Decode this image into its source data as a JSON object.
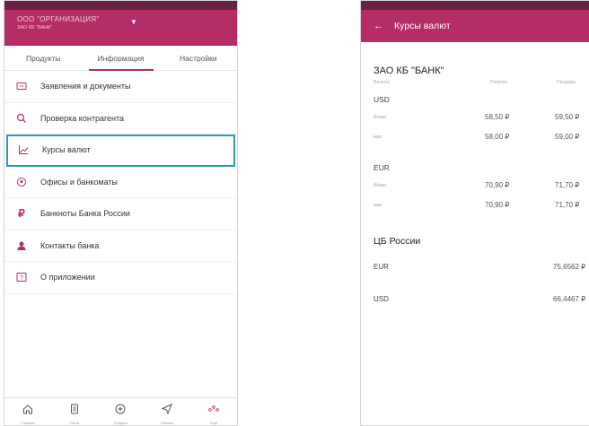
{
  "left": {
    "org_name": "ООО \"ОРГАНИЗАЦИЯ\"",
    "org_sub": "ЗАО КБ \"БАНК\"",
    "tabs": [
      "Продукты",
      "Информация",
      "Настройки"
    ],
    "menu": [
      {
        "label": "Заявления и документы",
        "icon": "envelope-icon"
      },
      {
        "label": "Проверка контрагента",
        "icon": "search-icon"
      },
      {
        "label": "Курсы валют",
        "icon": "chart-icon"
      },
      {
        "label": "Офисы и банкоматы",
        "icon": "location-pin-icon"
      },
      {
        "label": "Банкноты Банка России",
        "icon": "ruble-icon"
      },
      {
        "label": "Контакты банка",
        "icon": "contact-icon"
      },
      {
        "label": "О приложении",
        "icon": "info-icon"
      }
    ],
    "nav": [
      {
        "label": "Главная",
        "icon": "home-icon"
      },
      {
        "label": "Счета",
        "icon": "document-icon"
      },
      {
        "label": "Создать",
        "icon": "plus-circle-icon"
      },
      {
        "label": "Письма",
        "icon": "send-icon"
      },
      {
        "label": "Ещё",
        "icon": "more-icon"
      }
    ]
  },
  "right": {
    "title": "Курсы валют",
    "bank": "ЗАО КБ \"БАНК\"",
    "col_currency": "Валюта",
    "col_buy": "Покупка",
    "col_sell": "Продажа",
    "currencies": [
      {
        "code": "USD",
        "rows": [
          {
            "kind": "б/нал",
            "buy": "58,50 ₽",
            "sell": "59,50 ₽"
          },
          {
            "kind": "нал",
            "buy": "58,00 ₽",
            "sell": "59,00 ₽"
          }
        ]
      },
      {
        "code": "EUR",
        "rows": [
          {
            "kind": "б/нал",
            "buy": "70,90 ₽",
            "sell": "71,70 ₽"
          },
          {
            "kind": "нал",
            "buy": "70,90 ₽",
            "sell": "71,70 ₽"
          }
        ]
      }
    ],
    "cb_title": "ЦБ России",
    "cb_rates": [
      {
        "code": "EUR",
        "value": "75,6562 ₽"
      },
      {
        "code": "USD",
        "value": "66,4467 ₽"
      }
    ]
  },
  "colors": {
    "brand": "#b42d66",
    "status": "#6b2046",
    "highlight": "#2e9bb5"
  }
}
